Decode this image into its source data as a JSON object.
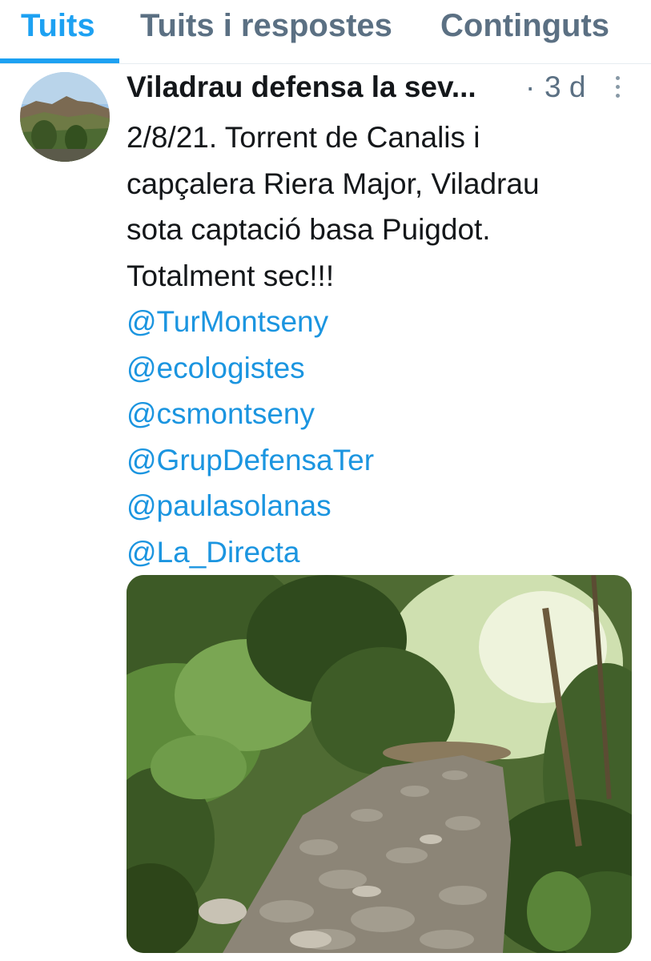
{
  "tabs": [
    {
      "label": "Tuits",
      "active": true
    },
    {
      "label": "Tuits i respostes",
      "active": false
    },
    {
      "label": "Continguts",
      "active": false
    }
  ],
  "tweet": {
    "author": "Viladrau defensa la sev...",
    "separator": "·",
    "time": "3 d",
    "text_lines": [
      "2/8/21. Torrent de Canalis i",
      "capçalera Riera Major, Viladrau",
      "sota captació basa Puigdot.",
      "Totalment sec!!!"
    ],
    "mentions": [
      "@TurMontseny",
      "@ecologistes",
      "@csmontseny",
      "@GrupDefensaTer",
      "@paulasolanas",
      "@La_Directa"
    ]
  },
  "colors": {
    "accent": "#1da1f2",
    "mention": "#1b95e0",
    "secondary_text": "#5b7083",
    "primary_text": "#14171a"
  },
  "icons": {
    "more": "more-vertical-icon"
  }
}
